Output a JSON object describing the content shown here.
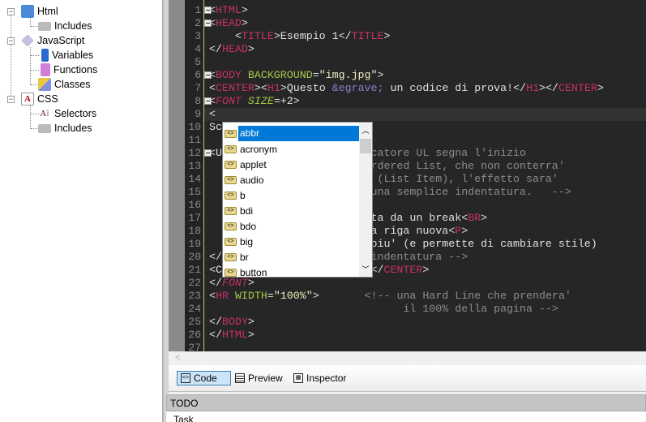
{
  "tree": {
    "items": [
      {
        "label": "Html",
        "icon": "html-icon"
      },
      {
        "label": "Includes",
        "icon": "folder-icon"
      },
      {
        "label": "JavaScript",
        "icon": "javascript-icon"
      },
      {
        "label": "Variables",
        "icon": "variable-icon"
      },
      {
        "label": "Functions",
        "icon": "function-icon"
      },
      {
        "label": "Classes",
        "icon": "class-icon"
      },
      {
        "label": "CSS",
        "icon": "css-icon"
      },
      {
        "label": "Selectors",
        "icon": "selector-icon"
      },
      {
        "label": "Includes",
        "icon": "folder-icon"
      }
    ]
  },
  "editor": {
    "line_numbers": [
      "1",
      "2",
      "3",
      "4",
      "5",
      "6",
      "7",
      "8",
      "9",
      "10",
      "11",
      "12",
      "13",
      "14",
      "15",
      "16",
      "17",
      "18",
      "19",
      "20",
      "21",
      "22",
      "23",
      "24",
      "25",
      "26",
      "27"
    ],
    "lines": {
      "l1": [
        "<",
        "HTML",
        ">"
      ],
      "l2": [
        "<",
        "HEAD",
        ">"
      ],
      "l3": [
        "    <",
        "TITLE",
        ">Esempio 1</",
        "TITLE",
        ">"
      ],
      "l4": [
        "</",
        "HEAD",
        ">"
      ],
      "l6": [
        "<",
        "BODY",
        " ",
        "BACKGROUND",
        "=",
        "\"img.jpg\"",
        ">"
      ],
      "l7": [
        "<",
        "CENTER",
        "><",
        "H1",
        ">Questo ",
        "&egrave;",
        " un codice di prova!</",
        "H1",
        "></",
        "CENTER",
        ">"
      ],
      "l8": [
        "<",
        "FONT",
        " ",
        "SIZE",
        "=+2",
        ">"
      ],
      "l9": "<",
      "l10": "Sc",
      "l12": [
        "<U",
        "                       catore UL segna l'inizio"
      ],
      "l13": "                         rdered List, che non conterra'",
      "l14": "                          (List Item), l'effetto sara'",
      "l15": "                         una semplice indentatura.   -->",
      "l17": [
        "                         ta da un break<",
        "BR",
        ">"
      ],
      "l18": [
        "                         a riga nuova<",
        "P",
        ">"
      ],
      "l19": "                         piu' (e permette di cambiare stile)",
      "l20": [
        "</",
        "                       indentatura -->"
      ],
      "l21": [
        "<C",
        "                       </",
        "CENTER",
        ">"
      ],
      "l22": [
        "</",
        "FONT",
        ">"
      ],
      "l23": [
        "<",
        "HR",
        " ",
        "WIDTH",
        "=",
        "\"100%\"",
        ">",
        "       <!-- una Hard Line che prendera'"
      ],
      "l24": "                              il 100% della pagina -->",
      "l25": [
        "</",
        "BODY",
        ">"
      ],
      "l26": [
        "</",
        "HTML",
        ">"
      ]
    }
  },
  "autocomplete": {
    "items": [
      "abbr",
      "acronym",
      "applet",
      "audio",
      "b",
      "bdi",
      "bdo",
      "big",
      "br",
      "button"
    ],
    "selected": "abbr"
  },
  "scroll_left": "<",
  "tabs": [
    {
      "label": "Code"
    },
    {
      "label": "Preview"
    },
    {
      "label": "Inspector"
    }
  ],
  "todo": {
    "title": "TODO",
    "column": "Task"
  },
  "colors": {
    "tag": "#c8306a",
    "attr": "#a6c94a",
    "selection": "#0078d7",
    "editor_bg": "#262626"
  }
}
